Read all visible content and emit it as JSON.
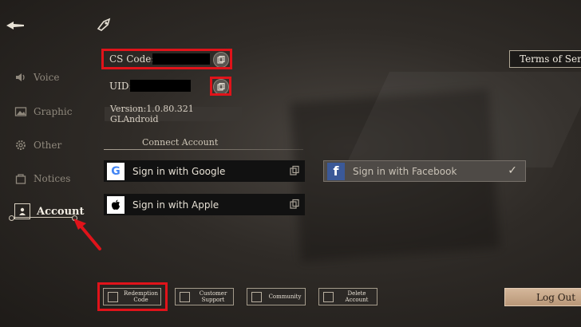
{
  "sidebar": {
    "items": [
      {
        "label": "Voice",
        "icon": "speaker-icon"
      },
      {
        "label": "Graphic",
        "icon": "image-icon"
      },
      {
        "label": "Other",
        "icon": "gear-icon"
      },
      {
        "label": "Notices",
        "icon": "notice-icon"
      },
      {
        "label": "Account",
        "icon": "account-icon",
        "active": true
      }
    ]
  },
  "account": {
    "cs_code_label": "CS Code:",
    "uid_label": "UID:",
    "version": "Version:1.0.80.321 GLAndroid",
    "connect_title": "Connect Account",
    "google_label": "Sign in with Google",
    "apple_label": "Sign in with Apple",
    "facebook_label": "Sign in with Facebook",
    "facebook_connected": true
  },
  "header": {
    "terms_label": "Terms of Serv"
  },
  "bottom": {
    "redemption_label_1": "Redemption",
    "redemption_label_2": "Code",
    "support_label_1": "Customer",
    "support_label_2": "Support",
    "community_label": "Community",
    "delete_label_1": "Delete",
    "delete_label_2": "Account",
    "logout_label": "Log Out"
  },
  "colors": {
    "highlight_red": "#e0131a",
    "accent_tan": "#c8a98a"
  }
}
